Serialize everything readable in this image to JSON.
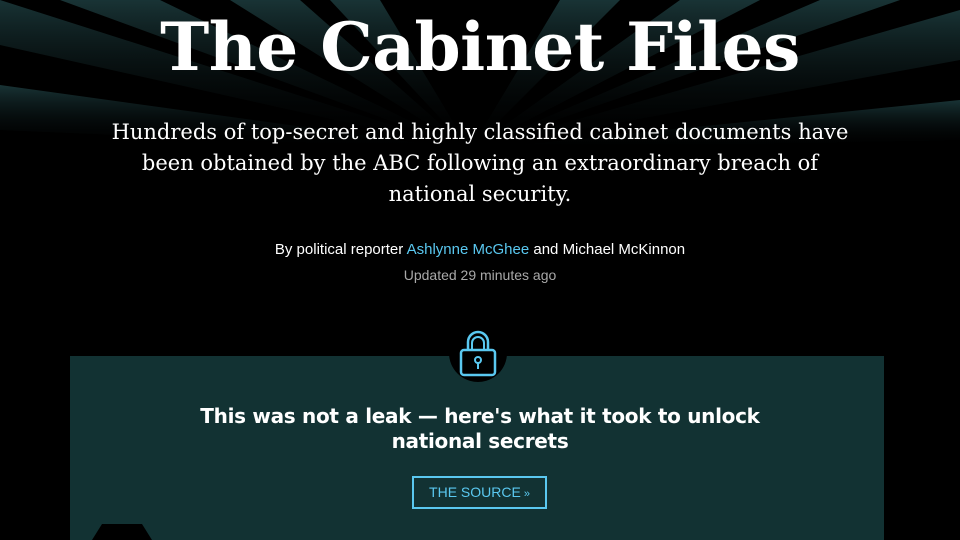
{
  "header": {
    "title": "The Cabinet Files",
    "dek": "Hundreds of top-secret and highly classified cabinet documents have been obtained by the ABC following an extraordinary breach of national security."
  },
  "byline": {
    "prefix": "By political reporter",
    "author_1": "Ashlynne McGhee",
    "joiner": "and",
    "author_2": "Michael McKinnon",
    "updated": "Updated 29 minutes ago"
  },
  "panel": {
    "icon": "lock-icon",
    "headline_line_1": "This was not a leak — here's what it took to unlock",
    "headline_line_2": "national secrets",
    "button_label": "THE SOURCE",
    "button_icon": "double-chevron-down-icon"
  },
  "colors": {
    "background": "#000000",
    "panel": "#123233",
    "accent": "#5ac8f0",
    "muted_text": "#a9a9a9"
  }
}
